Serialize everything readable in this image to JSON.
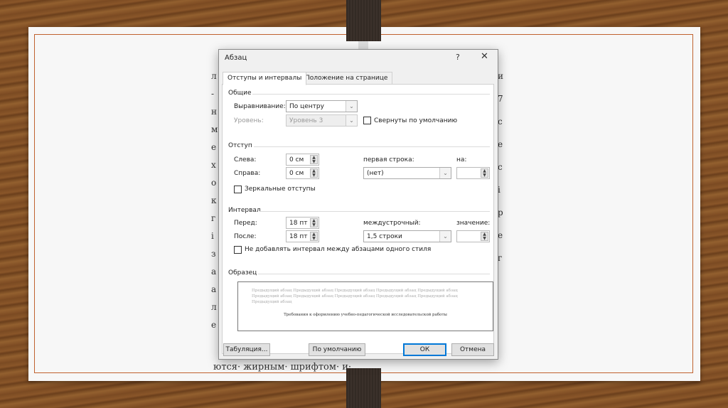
{
  "background_fragments": {
    "left": [
      "л",
      "-",
      "н",
      "м",
      "е",
      "х",
      "о",
      "к",
      "г",
      "і",
      "з",
      "а",
      "а",
      "л",
      "е"
    ],
    "right": [
      "и",
      "7",
      "с",
      "е",
      "с",
      "і",
      "р",
      "е",
      "г"
    ],
    "bottom": "ются· жирным· шрифтом· и·"
  },
  "dialog": {
    "title": "Абзац",
    "help_label": "?",
    "close_label": "✕",
    "tabs": [
      {
        "label": "Отступы и интервалы",
        "active": true
      },
      {
        "label": "Положение на странице",
        "active": false
      }
    ],
    "general": {
      "heading": "Общие",
      "alignment_label": "Выравнивание:",
      "alignment_value": "По центру",
      "level_label": "Уровень:",
      "level_value": "Уровень 3",
      "collapsed_label": "Свернуты по умолчанию",
      "collapsed_checked": false
    },
    "indent": {
      "heading": "Отступ",
      "left_label": "Слева:",
      "left_value": "0 см",
      "right_label": "Справа:",
      "right_value": "0 см",
      "first_line_label": "первая строка:",
      "first_line_value": "(нет)",
      "by_label": "на:",
      "by_value": "",
      "mirror_label": "Зеркальные отступы",
      "mirror_checked": false
    },
    "spacing": {
      "heading": "Интервал",
      "before_label": "Перед:",
      "before_value": "18 пт",
      "after_label": "После:",
      "after_value": "18 пт",
      "line_label": "междустрочный:",
      "line_value": "1,5 строки",
      "at_label": "значение:",
      "at_value": "",
      "no_space_label": "Не добавлять интервал между абзацами одного стиля",
      "no_space_checked": false
    },
    "preview": {
      "heading": "Образец",
      "prev_line1": "Предыдущий абзац Предыдущий абзац Предыдущий абзац Предыдущий абзац Предыдущий абзац",
      "prev_line2": "Предыдущий абзац Предыдущий абзац Предыдущий абзац Предыдущий абзац Предыдущий абзац",
      "prev_line3": "Предыдущий абзац",
      "sample": "Требования к оформлению учебно-педагогической исследовательской работы"
    },
    "buttons": {
      "tabs": "Табуляция...",
      "default": "По умолчанию",
      "ok": "ОК",
      "cancel": "Отмена"
    }
  },
  "colors": {
    "accent": "#0078d7",
    "frame": "#c0622e"
  }
}
